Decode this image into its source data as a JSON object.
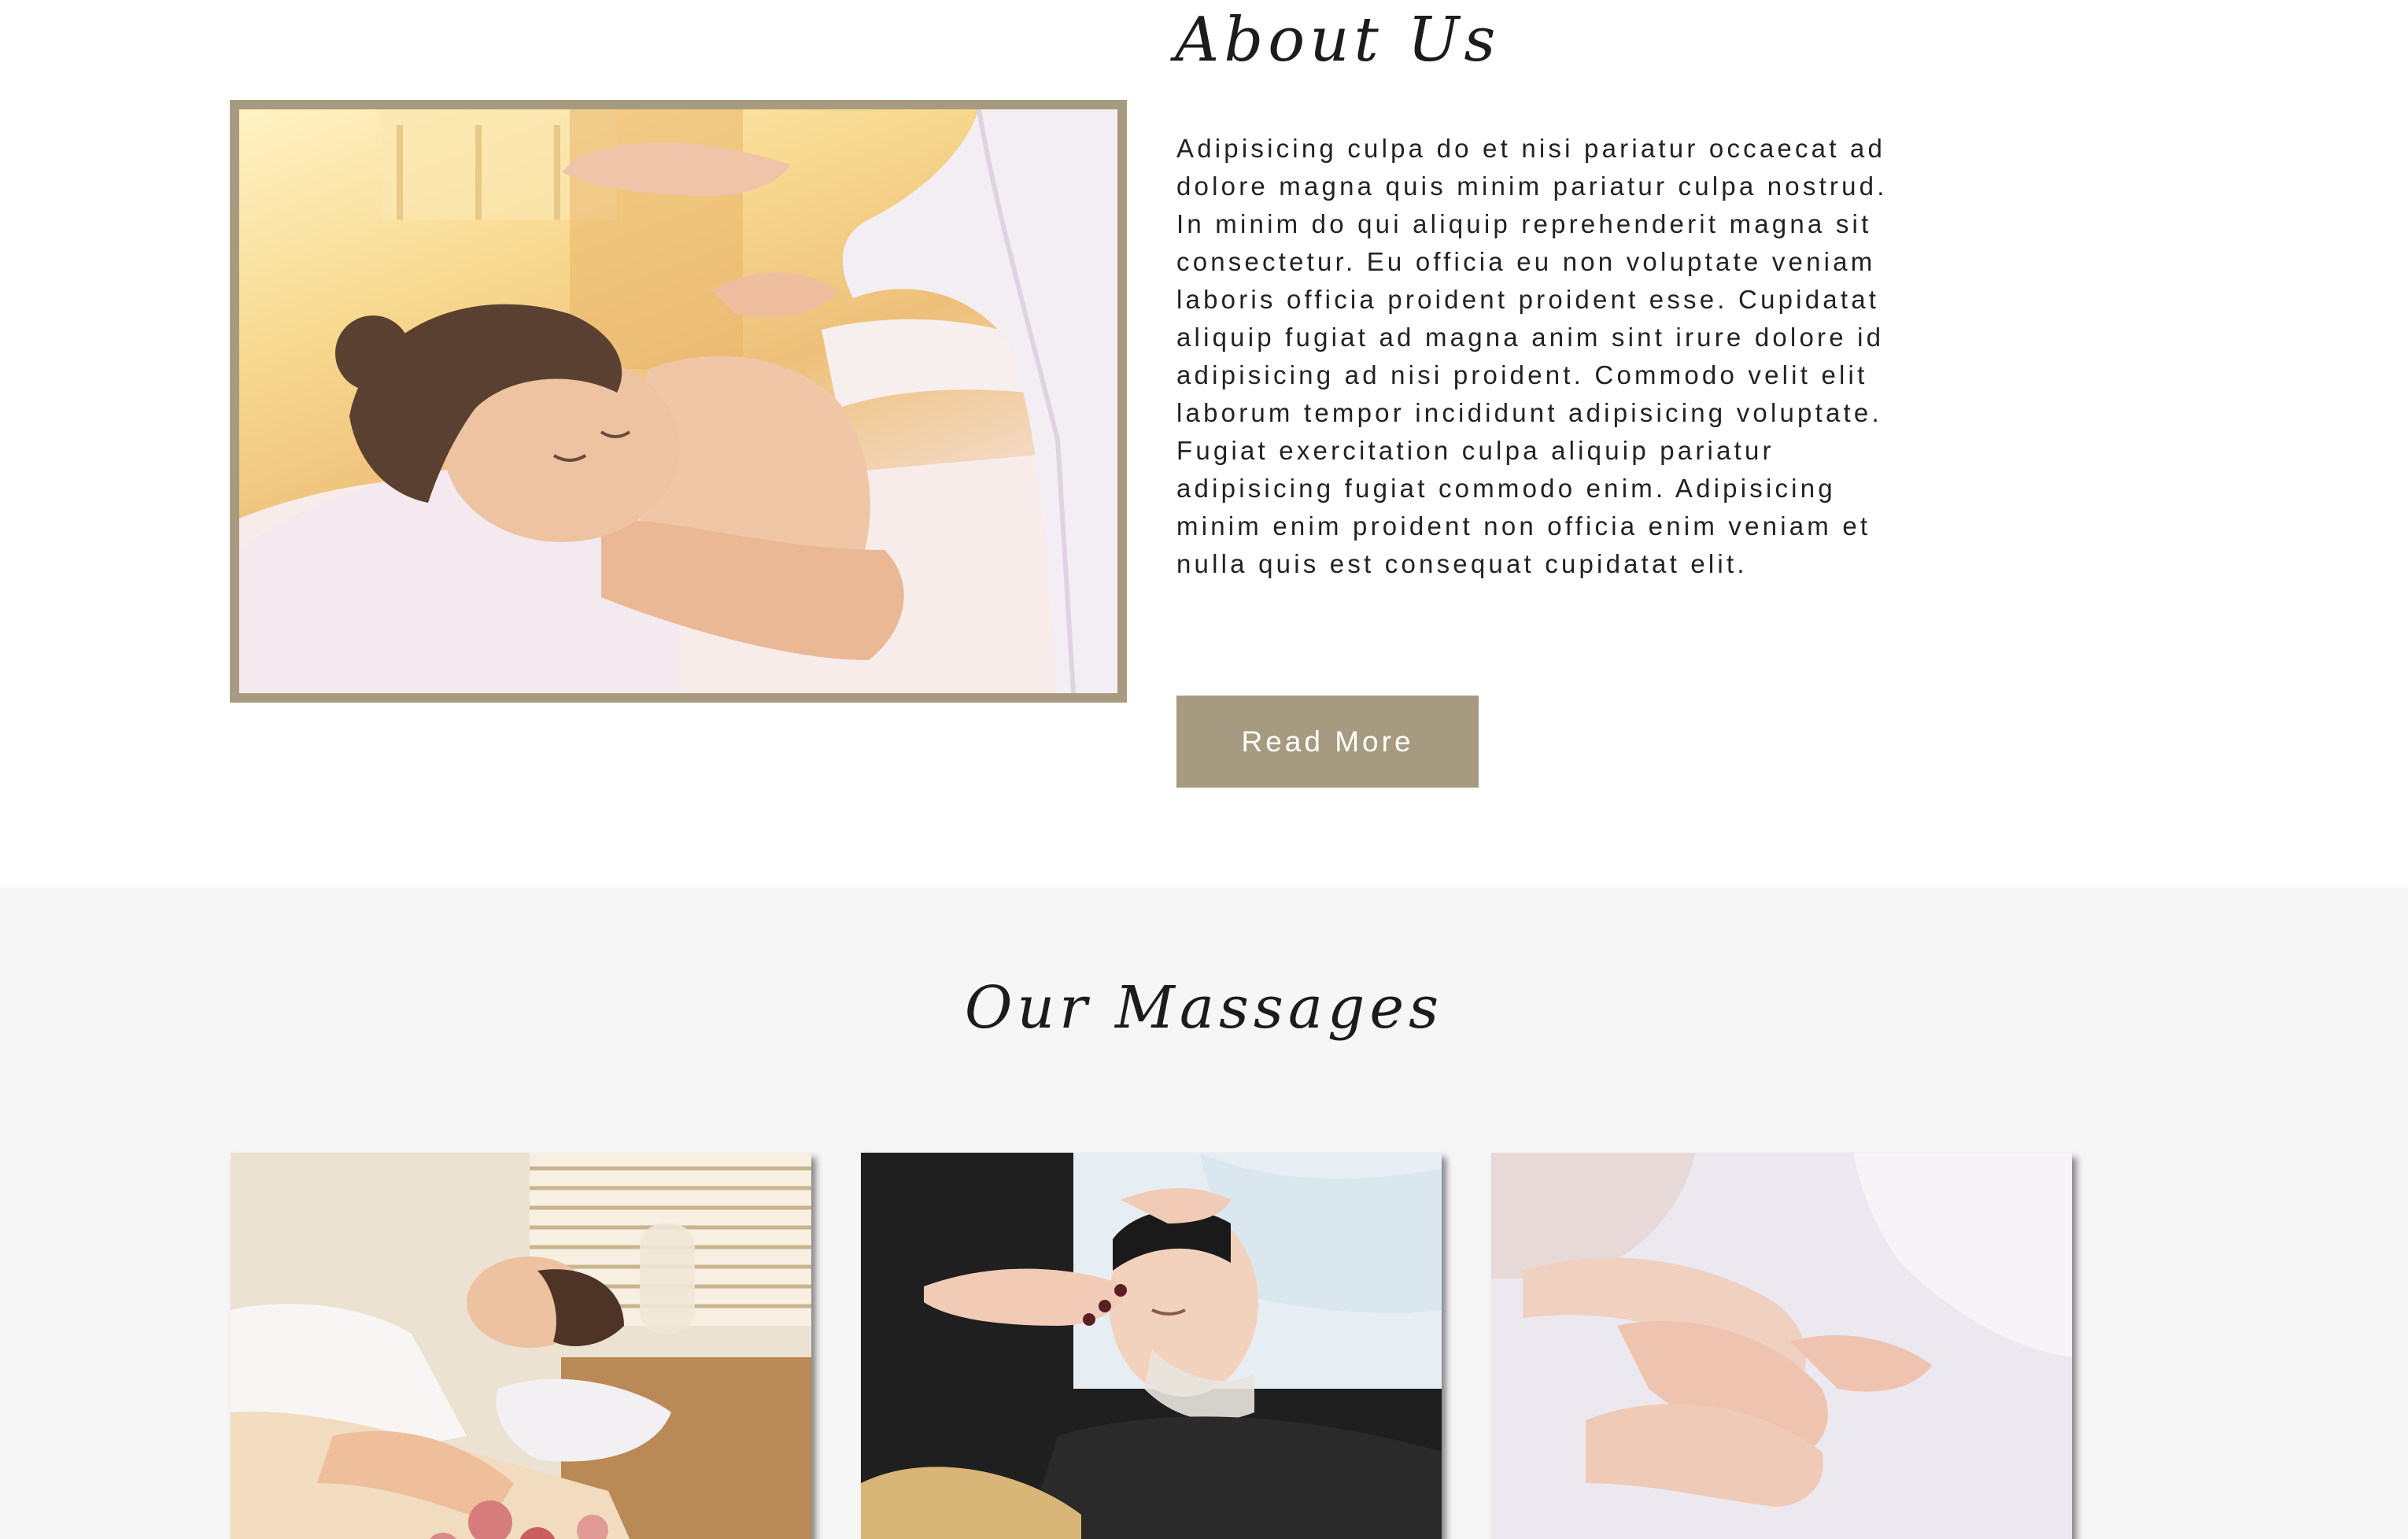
{
  "about": {
    "title": "About Us",
    "body": "Adipisicing culpa do et nisi pariatur occaecat ad dolore magna quis minim pariatur culpa nostrud. In minim do qui aliquip reprehenderit magna sit consectetur. Eu officia eu non voluptate veniam laboris officia proident proident esse. Cupidatat aliquip fugiat ad magna anim sint irure dolore id adipisicing ad nisi proident. Commodo velit elit laborum tempor incididunt adipisicing voluptate. Fugiat exercitation culpa aliquip pariatur adipisicing fugiat commodo enim. Adipisicing minim enim proident non officia enim veniam et nulla quis est consequat cupidatat elit.",
    "read_more_label": "Read More"
  },
  "massages": {
    "title": "Our Massages"
  },
  "colors": {
    "accent": "#a69a80",
    "section_bg": "#f6f6f6",
    "heading": "#1c1c1c"
  }
}
